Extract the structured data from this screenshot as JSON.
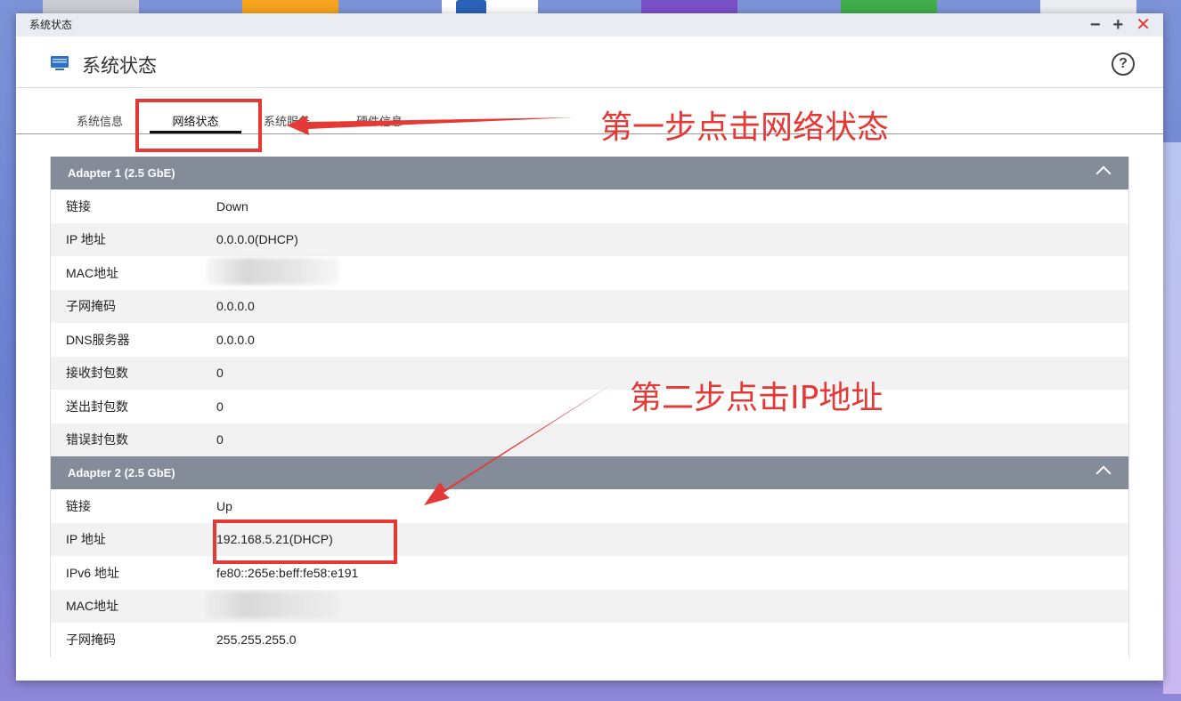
{
  "window": {
    "title": "系统状态",
    "app_title": "系统状态",
    "help_glyph": "?",
    "controls": {
      "minimize": "−",
      "maximize": "+",
      "close": "✕"
    }
  },
  "tabs": [
    {
      "label": "系统信息"
    },
    {
      "label": "网络状态",
      "active": true
    },
    {
      "label": "系统服务"
    },
    {
      "label": "硬件信息"
    }
  ],
  "adapters": [
    {
      "title": "Adapter 1 (2.5 GbE)",
      "rows": [
        {
          "k": "链接",
          "v": "Down"
        },
        {
          "k": "IP 地址",
          "v": "0.0.0.0(DHCP)"
        },
        {
          "k": "MAC地址",
          "v": ""
        },
        {
          "k": "子网掩码",
          "v": "0.0.0.0"
        },
        {
          "k": "DNS服务器",
          "v": "0.0.0.0"
        },
        {
          "k": "接收封包数",
          "v": "0"
        },
        {
          "k": "送出封包数",
          "v": "0"
        },
        {
          "k": "错误封包数",
          "v": "0"
        }
      ]
    },
    {
      "title": "Adapter 2 (2.5 GbE)",
      "rows": [
        {
          "k": "链接",
          "v": "Up"
        },
        {
          "k": "IP 地址",
          "v": "192.168.5.21(DHCP)"
        },
        {
          "k": "IPv6 地址",
          "v": "fe80::265e:beff:fe58:e191"
        },
        {
          "k": "MAC地址",
          "v": ""
        },
        {
          "k": "子网掩码",
          "v": "255.255.255.0"
        }
      ]
    }
  ],
  "annotations": {
    "step1": "第一步点击网络状态",
    "step2": "第二步点击IP地址"
  },
  "colors": {
    "accent_red": "#e53935",
    "section_header": "#848b99",
    "row_alt": "#f2f2f2"
  }
}
